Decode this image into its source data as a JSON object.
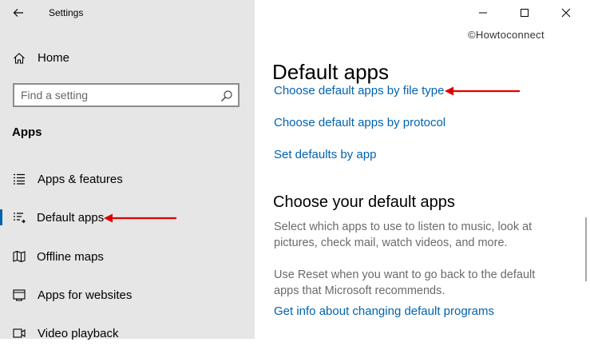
{
  "window": {
    "title": "Settings",
    "caption_buttons": {
      "minimize": "minimize-icon",
      "maximize": "maximize-icon",
      "close": "close-icon"
    }
  },
  "watermark": "©Howtoconnect",
  "sidebar": {
    "home_label": "Home",
    "search_placeholder": "Find a setting",
    "section_title": "Apps",
    "items": [
      {
        "label": "Apps & features",
        "icon": "apps-features-icon",
        "selected": false
      },
      {
        "label": "Default apps",
        "icon": "default-apps-icon",
        "selected": true
      },
      {
        "label": "Offline maps",
        "icon": "offline-maps-icon",
        "selected": false
      },
      {
        "label": "Apps for websites",
        "icon": "apps-websites-icon",
        "selected": false
      },
      {
        "label": "Video playback",
        "icon": "video-playback-icon",
        "selected": false
      }
    ]
  },
  "main": {
    "title": "Default apps",
    "links": {
      "by_file_type": "Choose default apps by file type",
      "by_protocol": "Choose default apps by protocol",
      "by_app": "Set defaults by app"
    },
    "subheading": "Choose your default apps",
    "description": "Select which apps to use to listen to music, look at pictures, check mail, watch videos, and more.",
    "reset_text": "Use Reset when you want to go back to the default apps that Microsoft recommends.",
    "info_link": "Get info about changing default programs"
  },
  "colors": {
    "accent": "#0063b1",
    "sidebar_bg": "#e6e6e6",
    "annotation_arrow": "#e00000"
  }
}
